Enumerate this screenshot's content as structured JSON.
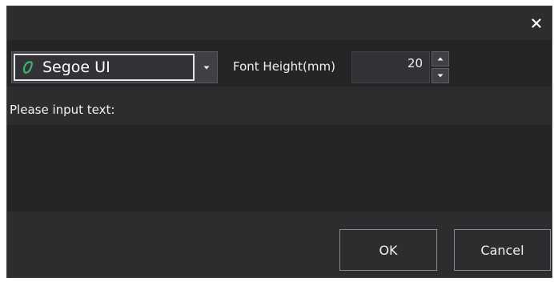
{
  "toolbar": {
    "font_name": "Segoe UI",
    "font_height_label": "Font Height(mm)",
    "font_height_value": "20"
  },
  "prompt": {
    "label": "Please input text:",
    "text_value": ""
  },
  "buttons": {
    "ok_label": "OK",
    "cancel_label": "Cancel"
  },
  "icons": {
    "close": "close-icon",
    "font": "font-type-icon",
    "dropdown": "chevron-down-icon",
    "up": "arrow-up-icon",
    "down": "arrow-down-icon"
  },
  "colors": {
    "dialog_bg": "#2d2d30",
    "panel_bg": "#252526",
    "font_icon_accent": "#3cb371",
    "text": "#f1f1f1"
  }
}
